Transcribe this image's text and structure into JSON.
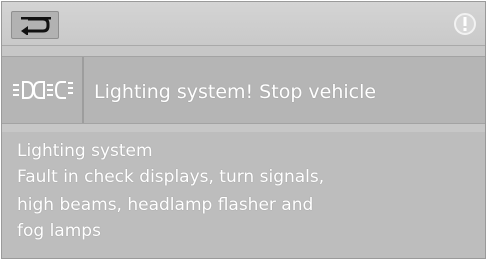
{
  "topbar": {
    "back_icon": "back-arrow-icon",
    "info_icon": "info-icon"
  },
  "message": {
    "symbol_icon": "lighting-fault-lamps-icon",
    "title": "Lighting system! Stop vehicle"
  },
  "detail": {
    "lines": [
      "Lighting system",
      "Fault in check displays, turn signals,",
      "high beams, headlamp flasher and",
      "fog lamps"
    ]
  },
  "colors": {
    "text": "#ffffff",
    "background": "#c7c7c7"
  }
}
